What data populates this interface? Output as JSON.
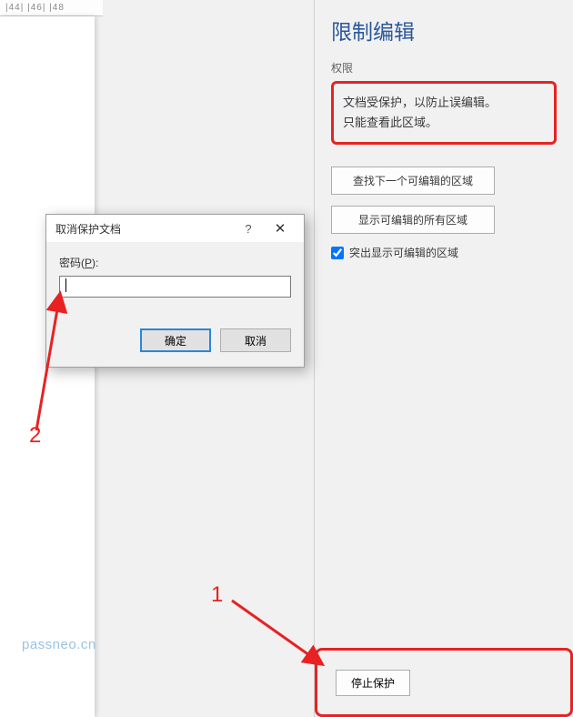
{
  "ruler": {
    "marks": "|44|  |46|  |48"
  },
  "sidebar": {
    "title": "限制编辑",
    "perm_label": "权限",
    "info_line1": "文档受保护，以防止误编辑。",
    "info_line2": "只能查看此区域。",
    "btn_find_next": "查找下一个可编辑的区域",
    "btn_show_all": "显示可编辑的所有区域",
    "cb_highlight": "突出显示可编辑的区域",
    "cb_checked": true,
    "btn_stop_protect": "停止保护"
  },
  "dialog": {
    "title": "取消保护文档",
    "help": "?",
    "close": "✕",
    "pwd_label_pre": "密码(",
    "pwd_label_u": "P",
    "pwd_label_post": "):",
    "pwd_value": "",
    "btn_ok": "确定",
    "btn_cancel": "取消"
  },
  "annotations": {
    "label1": "1",
    "label2": "2"
  },
  "watermark": "passneo.cn",
  "colors": {
    "accent": "#2b579a",
    "highlight": "#e82222"
  }
}
